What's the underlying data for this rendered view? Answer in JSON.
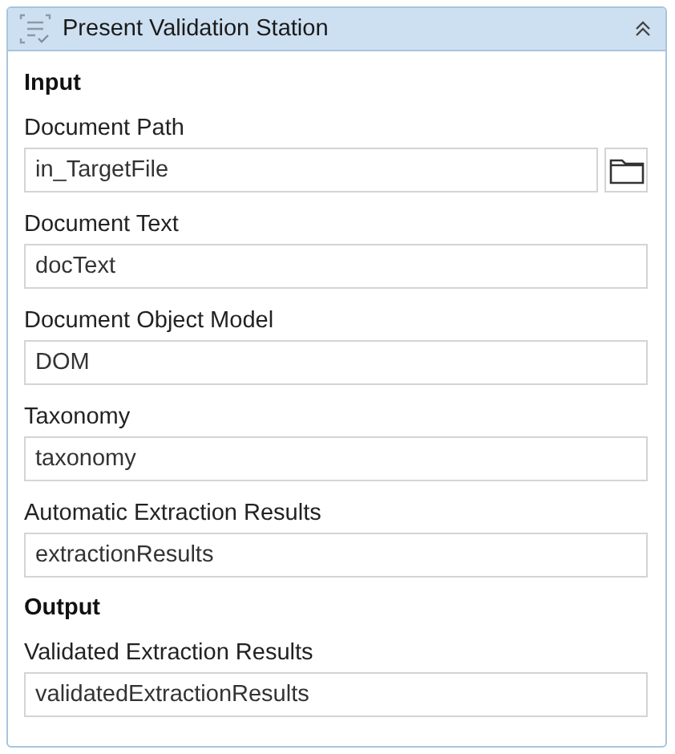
{
  "activity": {
    "title": "Present Validation Station",
    "expanded": true
  },
  "sections": [
    {
      "heading": "Input",
      "fields": [
        {
          "label": "Document Path",
          "value": "in_TargetFile",
          "kind": "path"
        },
        {
          "label": "Document Text",
          "value": "docText",
          "kind": "text"
        },
        {
          "label": "Document Object Model",
          "value": "DOM",
          "kind": "text"
        },
        {
          "label": "Taxonomy",
          "value": "taxonomy",
          "kind": "text"
        },
        {
          "label": "Automatic Extraction Results",
          "value": "extractionResults",
          "kind": "text"
        }
      ]
    },
    {
      "heading": "Output",
      "fields": [
        {
          "label": "Validated Extraction Results",
          "value": "validatedExtractionResults",
          "kind": "text"
        }
      ]
    }
  ]
}
